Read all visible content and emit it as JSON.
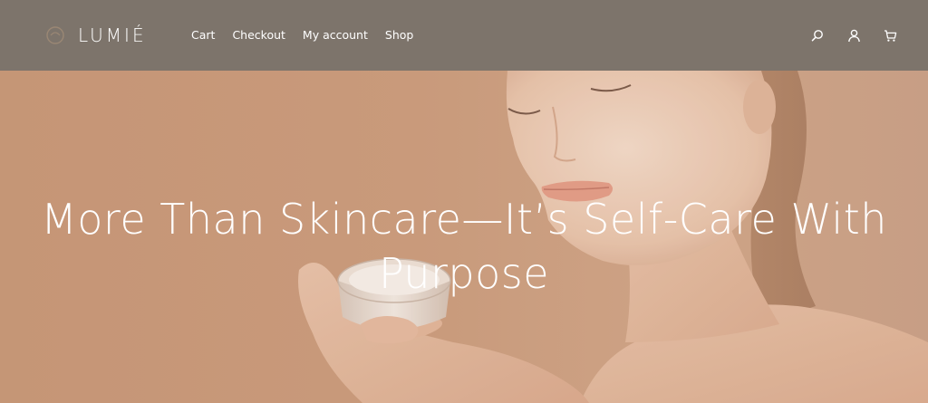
{
  "header": {
    "brand": "LUMIÉ",
    "nav": [
      {
        "label": "Cart"
      },
      {
        "label": "Checkout"
      },
      {
        "label": "My account"
      },
      {
        "label": "Shop"
      }
    ],
    "icons": [
      "search-icon",
      "account-icon",
      "cart-icon"
    ]
  },
  "hero": {
    "title": "More Than Skincare—It’s Self-Care With Purpose"
  },
  "colors": {
    "header_bg": "#7d746b",
    "hero_bg": "#c99a78",
    "text": "#ffffff"
  }
}
